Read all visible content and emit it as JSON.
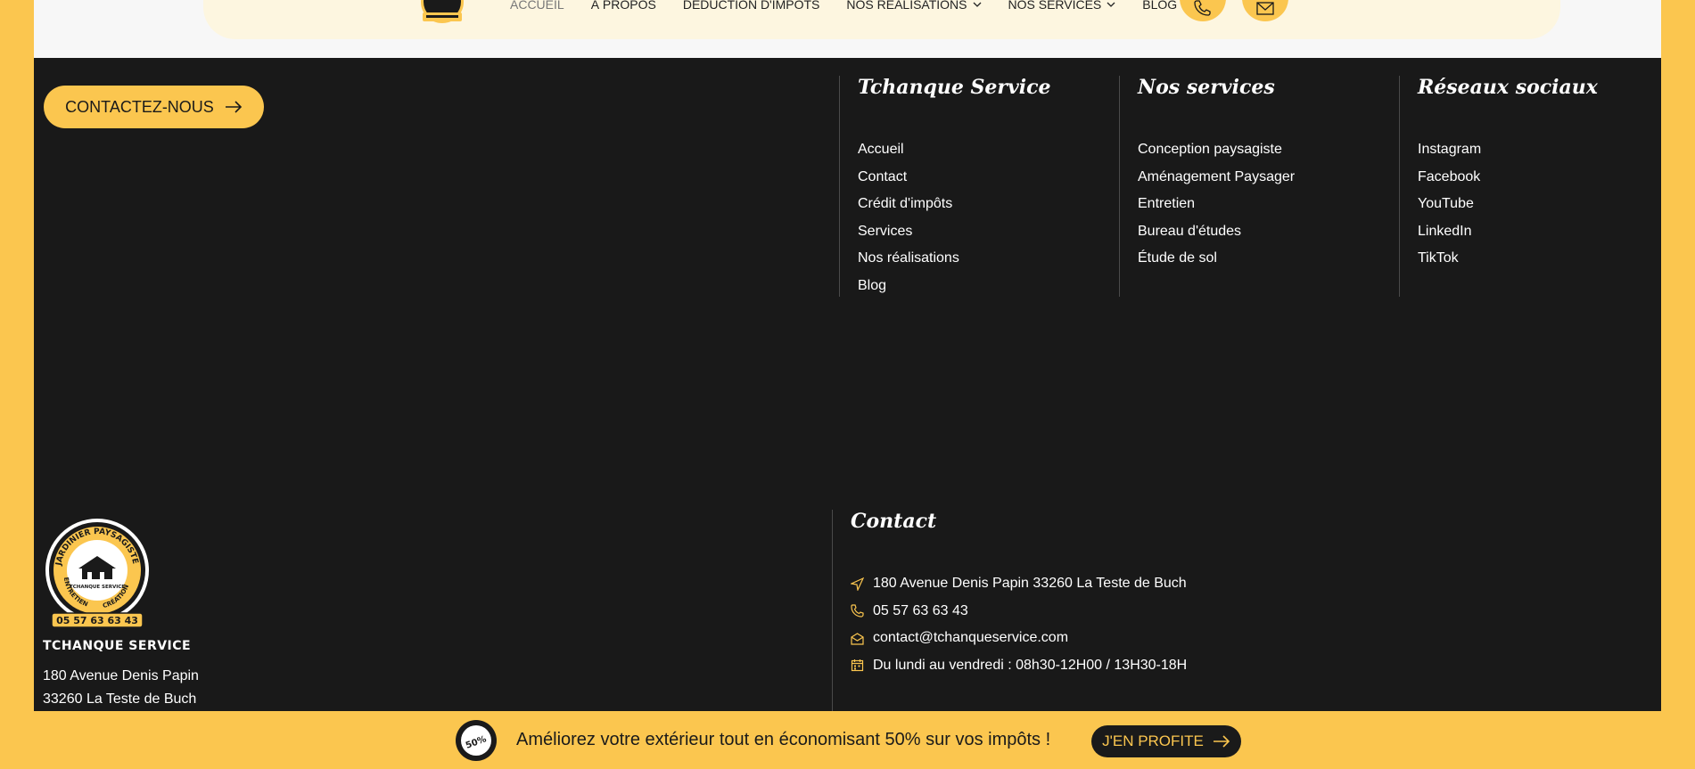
{
  "nav": {
    "items": [
      {
        "label": "ACCUEIL",
        "active": true,
        "dropdown": false
      },
      {
        "label": "À PROPOS",
        "active": false,
        "dropdown": false
      },
      {
        "label": "DEDUCTION D'IMPOTS",
        "active": false,
        "dropdown": false
      },
      {
        "label": "NOS RÉALISATIONS",
        "active": false,
        "dropdown": true
      },
      {
        "label": "NOS SERVICES",
        "active": false,
        "dropdown": true
      },
      {
        "label": "BLOG",
        "active": false,
        "dropdown": false
      }
    ],
    "phone_icon": "phone-icon",
    "mail_icon": "mail-icon"
  },
  "footer": {
    "contact_button": "CONTACTEZ-NOUS",
    "columns": [
      {
        "title": "Tchanque Service",
        "links": [
          "Accueil",
          "Contact",
          "Crédit d'impôts",
          "Services",
          "Nos réalisations",
          "Blog"
        ]
      },
      {
        "title": "Nos services",
        "links": [
          "Conception paysagiste",
          "Aménagement Paysager",
          "Entretien",
          "Bureau d'études",
          "Étude de sol"
        ]
      },
      {
        "title": "Réseaux sociaux",
        "links": [
          "Instagram",
          "Facebook",
          "YouTube",
          "LinkedIn",
          "TikTok"
        ]
      }
    ],
    "brand": {
      "logo_text_top": "JARDINIER PAYSAGISTE",
      "logo_text_bottom_left": "ENTRETIEN",
      "logo_text_bottom_right": "CRÉATION",
      "logo_center": "TCHANQUE SERVICE",
      "logo_phone": "05 57 63 63 43",
      "name": "TCHANQUE SERVICE",
      "address_line1": "180 Avenue Denis Papin",
      "address_line2": "33260 La Teste de Buch"
    },
    "contact": {
      "title": "Contact",
      "address": "180 Avenue Denis Papin  33260 La Teste de Buch",
      "phone": "05 57 63 63 43",
      "email": "contact@tchanqueservice.com",
      "hours": "Du lundi au vendredi : 08h30-12H00 / 13H30-18H"
    }
  },
  "promo": {
    "badge": "50%",
    "text": "Améliorez votre extérieur tout en économisant 50% sur vos impôts !",
    "button": "J'EN PROFITE"
  },
  "colors": {
    "accent": "#fbc64f",
    "dark": "#191919",
    "nav_bg": "#fdf6e0"
  }
}
